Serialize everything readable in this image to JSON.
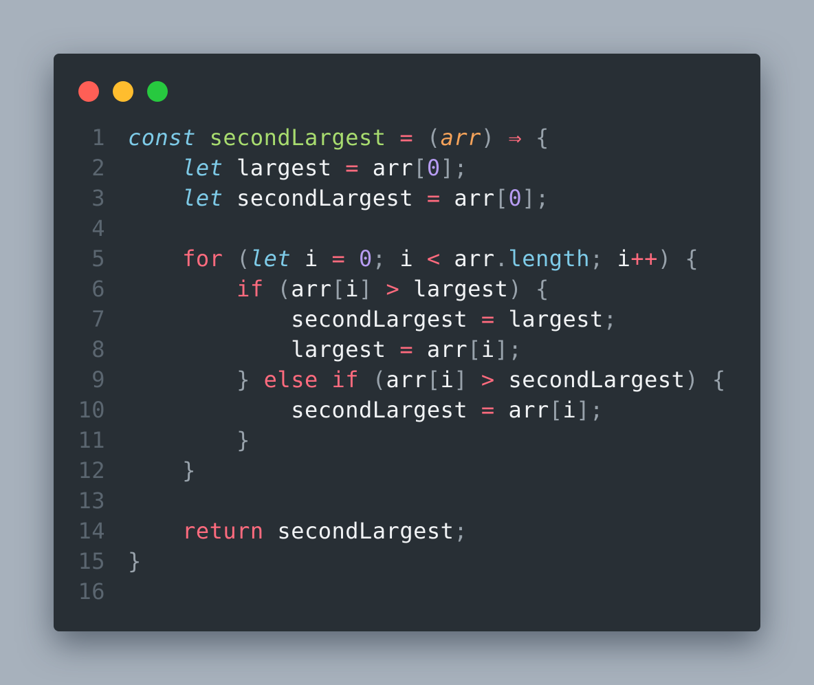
{
  "window": {
    "controls": [
      {
        "name": "close",
        "color": "#ff5f56"
      },
      {
        "name": "minimize",
        "color": "#ffbd2e"
      },
      {
        "name": "zoom",
        "color": "#27c93f"
      }
    ]
  },
  "theme": {
    "background": "#282f35",
    "plain": "#f1f3f5",
    "keyword": "#7ecbe8",
    "control": "#ff6b7e",
    "function_name": "#a8dc6f",
    "param": "#f6a35a",
    "number": "#b79cf2",
    "punct": "#98a2ab",
    "line_number": "#5b6670"
  },
  "code": {
    "lines": [
      {
        "n": "1",
        "tokens": [
          {
            "t": "const",
            "k": "keyword",
            "i": true
          },
          {
            "t": " ",
            "k": "plain"
          },
          {
            "t": "secondLargest",
            "k": "function_name"
          },
          {
            "t": " ",
            "k": "plain"
          },
          {
            "t": "=",
            "k": "control"
          },
          {
            "t": " ",
            "k": "plain"
          },
          {
            "t": "(",
            "k": "punct"
          },
          {
            "t": "arr",
            "k": "param",
            "i": true
          },
          {
            "t": ")",
            "k": "punct"
          },
          {
            "t": " ",
            "k": "plain"
          },
          {
            "t": "⇒",
            "k": "control"
          },
          {
            "t": " ",
            "k": "plain"
          },
          {
            "t": "{",
            "k": "punct"
          }
        ]
      },
      {
        "n": "2",
        "tokens": [
          {
            "t": "    ",
            "k": "plain"
          },
          {
            "t": "let",
            "k": "keyword",
            "i": true
          },
          {
            "t": " largest ",
            "k": "plain"
          },
          {
            "t": "=",
            "k": "control"
          },
          {
            "t": " arr",
            "k": "plain"
          },
          {
            "t": "[",
            "k": "punct"
          },
          {
            "t": "0",
            "k": "number"
          },
          {
            "t": "];",
            "k": "punct"
          }
        ]
      },
      {
        "n": "3",
        "tokens": [
          {
            "t": "    ",
            "k": "plain"
          },
          {
            "t": "let",
            "k": "keyword",
            "i": true
          },
          {
            "t": " secondLargest ",
            "k": "plain"
          },
          {
            "t": "=",
            "k": "control"
          },
          {
            "t": " arr",
            "k": "plain"
          },
          {
            "t": "[",
            "k": "punct"
          },
          {
            "t": "0",
            "k": "number"
          },
          {
            "t": "];",
            "k": "punct"
          }
        ]
      },
      {
        "n": "4",
        "tokens": []
      },
      {
        "n": "5",
        "tokens": [
          {
            "t": "    ",
            "k": "plain"
          },
          {
            "t": "for",
            "k": "control"
          },
          {
            "t": " ",
            "k": "plain"
          },
          {
            "t": "(",
            "k": "punct"
          },
          {
            "t": "let",
            "k": "keyword",
            "i": true
          },
          {
            "t": " i ",
            "k": "plain"
          },
          {
            "t": "=",
            "k": "control"
          },
          {
            "t": " ",
            "k": "plain"
          },
          {
            "t": "0",
            "k": "number"
          },
          {
            "t": ";",
            "k": "punct"
          },
          {
            "t": " i ",
            "k": "plain"
          },
          {
            "t": "<",
            "k": "control"
          },
          {
            "t": " arr",
            "k": "plain"
          },
          {
            "t": ".",
            "k": "punct"
          },
          {
            "t": "length",
            "k": "keyword"
          },
          {
            "t": ";",
            "k": "punct"
          },
          {
            "t": " i",
            "k": "plain"
          },
          {
            "t": "++",
            "k": "control"
          },
          {
            "t": ")",
            "k": "punct"
          },
          {
            "t": " ",
            "k": "plain"
          },
          {
            "t": "{",
            "k": "punct"
          }
        ]
      },
      {
        "n": "6",
        "tokens": [
          {
            "t": "        ",
            "k": "plain"
          },
          {
            "t": "if",
            "k": "control"
          },
          {
            "t": " ",
            "k": "plain"
          },
          {
            "t": "(",
            "k": "punct"
          },
          {
            "t": "arr",
            "k": "plain"
          },
          {
            "t": "[",
            "k": "punct"
          },
          {
            "t": "i",
            "k": "plain"
          },
          {
            "t": "]",
            "k": "punct"
          },
          {
            "t": " ",
            "k": "plain"
          },
          {
            "t": ">",
            "k": "control"
          },
          {
            "t": " largest",
            "k": "plain"
          },
          {
            "t": ")",
            "k": "punct"
          },
          {
            "t": " ",
            "k": "plain"
          },
          {
            "t": "{",
            "k": "punct"
          }
        ]
      },
      {
        "n": "7",
        "tokens": [
          {
            "t": "            secondLargest ",
            "k": "plain"
          },
          {
            "t": "=",
            "k": "control"
          },
          {
            "t": " largest",
            "k": "plain"
          },
          {
            "t": ";",
            "k": "punct"
          }
        ]
      },
      {
        "n": "8",
        "tokens": [
          {
            "t": "            largest ",
            "k": "plain"
          },
          {
            "t": "=",
            "k": "control"
          },
          {
            "t": " arr",
            "k": "plain"
          },
          {
            "t": "[",
            "k": "punct"
          },
          {
            "t": "i",
            "k": "plain"
          },
          {
            "t": "];",
            "k": "punct"
          }
        ]
      },
      {
        "n": "9",
        "tokens": [
          {
            "t": "        ",
            "k": "plain"
          },
          {
            "t": "}",
            "k": "punct"
          },
          {
            "t": " ",
            "k": "plain"
          },
          {
            "t": "else",
            "k": "control"
          },
          {
            "t": " ",
            "k": "plain"
          },
          {
            "t": "if",
            "k": "control"
          },
          {
            "t": " ",
            "k": "plain"
          },
          {
            "t": "(",
            "k": "punct"
          },
          {
            "t": "arr",
            "k": "plain"
          },
          {
            "t": "[",
            "k": "punct"
          },
          {
            "t": "i",
            "k": "plain"
          },
          {
            "t": "]",
            "k": "punct"
          },
          {
            "t": " ",
            "k": "plain"
          },
          {
            "t": ">",
            "k": "control"
          },
          {
            "t": " secondLargest",
            "k": "plain"
          },
          {
            "t": ")",
            "k": "punct"
          },
          {
            "t": " ",
            "k": "plain"
          },
          {
            "t": "{",
            "k": "punct"
          }
        ]
      },
      {
        "n": "10",
        "tokens": [
          {
            "t": "            secondLargest ",
            "k": "plain"
          },
          {
            "t": "=",
            "k": "control"
          },
          {
            "t": " arr",
            "k": "plain"
          },
          {
            "t": "[",
            "k": "punct"
          },
          {
            "t": "i",
            "k": "plain"
          },
          {
            "t": "];",
            "k": "punct"
          }
        ]
      },
      {
        "n": "11",
        "tokens": [
          {
            "t": "        ",
            "k": "plain"
          },
          {
            "t": "}",
            "k": "punct"
          }
        ]
      },
      {
        "n": "12",
        "tokens": [
          {
            "t": "    ",
            "k": "plain"
          },
          {
            "t": "}",
            "k": "punct"
          }
        ]
      },
      {
        "n": "13",
        "tokens": []
      },
      {
        "n": "14",
        "tokens": [
          {
            "t": "    ",
            "k": "plain"
          },
          {
            "t": "return",
            "k": "control"
          },
          {
            "t": " secondLargest",
            "k": "plain"
          },
          {
            "t": ";",
            "k": "punct"
          }
        ]
      },
      {
        "n": "15",
        "tokens": [
          {
            "t": "}",
            "k": "punct"
          }
        ]
      },
      {
        "n": "16",
        "tokens": []
      }
    ]
  }
}
